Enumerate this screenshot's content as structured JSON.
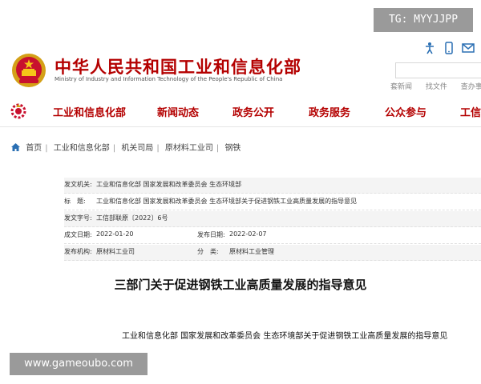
{
  "header": {
    "title_cn": "中华人民共和国工业和信息化部",
    "title_en": "Ministry of Industry and Information Technology of the People's Republic of China",
    "tg_badge": "TG: MYYJJPP",
    "quick_links": [
      "套新闻",
      "找文件",
      "查办事"
    ],
    "icons": [
      "accessibility-icon",
      "mobile-icon",
      "mail-icon"
    ]
  },
  "nav": {
    "items": [
      "工业和信息化部",
      "新闻动态",
      "政务公开",
      "政务服务",
      "公众参与",
      "工信"
    ]
  },
  "breadcrumb": [
    "首页",
    "工业和信息化部",
    "机关司局",
    "原材料工业司",
    "钢铁"
  ],
  "info": {
    "issuer_label": "发文机关:",
    "issuer_value": "工业和信息化部 国家发展和改革委员会 生态环境部",
    "title_label": "标　题:",
    "title_value": "工业和信息化部 国家发展和改革委员会 生态环境部关于促进钢铁工业高质量发展的指导意见",
    "docno_label": "发文字号:",
    "docno_value": "工信部联原〔2022〕6号",
    "created_label": "成文日期:",
    "created_value": "2022-01-20",
    "published_label": "发布日期:",
    "published_value": "2022-02-07",
    "org_label": "发布机构:",
    "org_value": "原材料工业司",
    "category_label": "分　类:",
    "category_value": "原材料工业管理"
  },
  "article": {
    "title": "三部门关于促进钢铁工业高质量发展的指导意见",
    "subtitle": "工业和信息化部 国家发展和改革委员会 生态环境部关于促进钢铁工业高质量发展的指导意见"
  },
  "watermark": "www.gameoubo.com",
  "colors": {
    "brand": "#b40000",
    "badge": "#9a9a9a"
  }
}
